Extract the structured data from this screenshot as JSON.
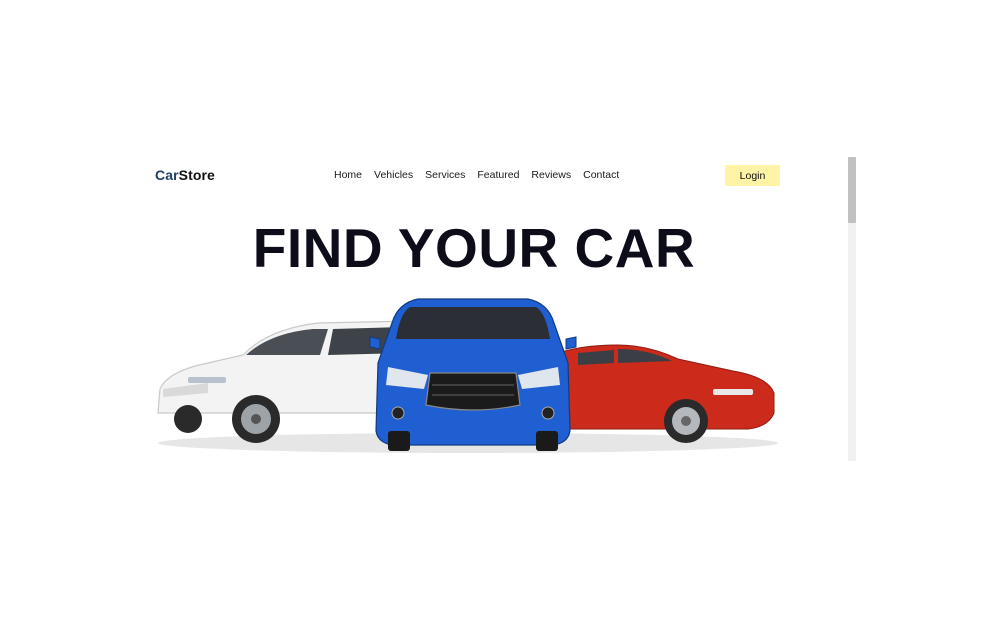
{
  "brand": {
    "part1": "Car",
    "part2": "Store"
  },
  "nav": {
    "items": [
      "Home",
      "Vehicles",
      "Services",
      "Featured",
      "Reviews",
      "Contact"
    ],
    "login_label": "Login"
  },
  "hero": {
    "headline": "FIND YOUR CAR"
  },
  "colors": {
    "brand_accent": "#1f3d66",
    "login_bg": "#fff3a6",
    "headline": "#0d0d1a",
    "car_white": "#f2f2f2",
    "car_blue": "#1f5fd1",
    "car_red": "#cc2a1a"
  }
}
